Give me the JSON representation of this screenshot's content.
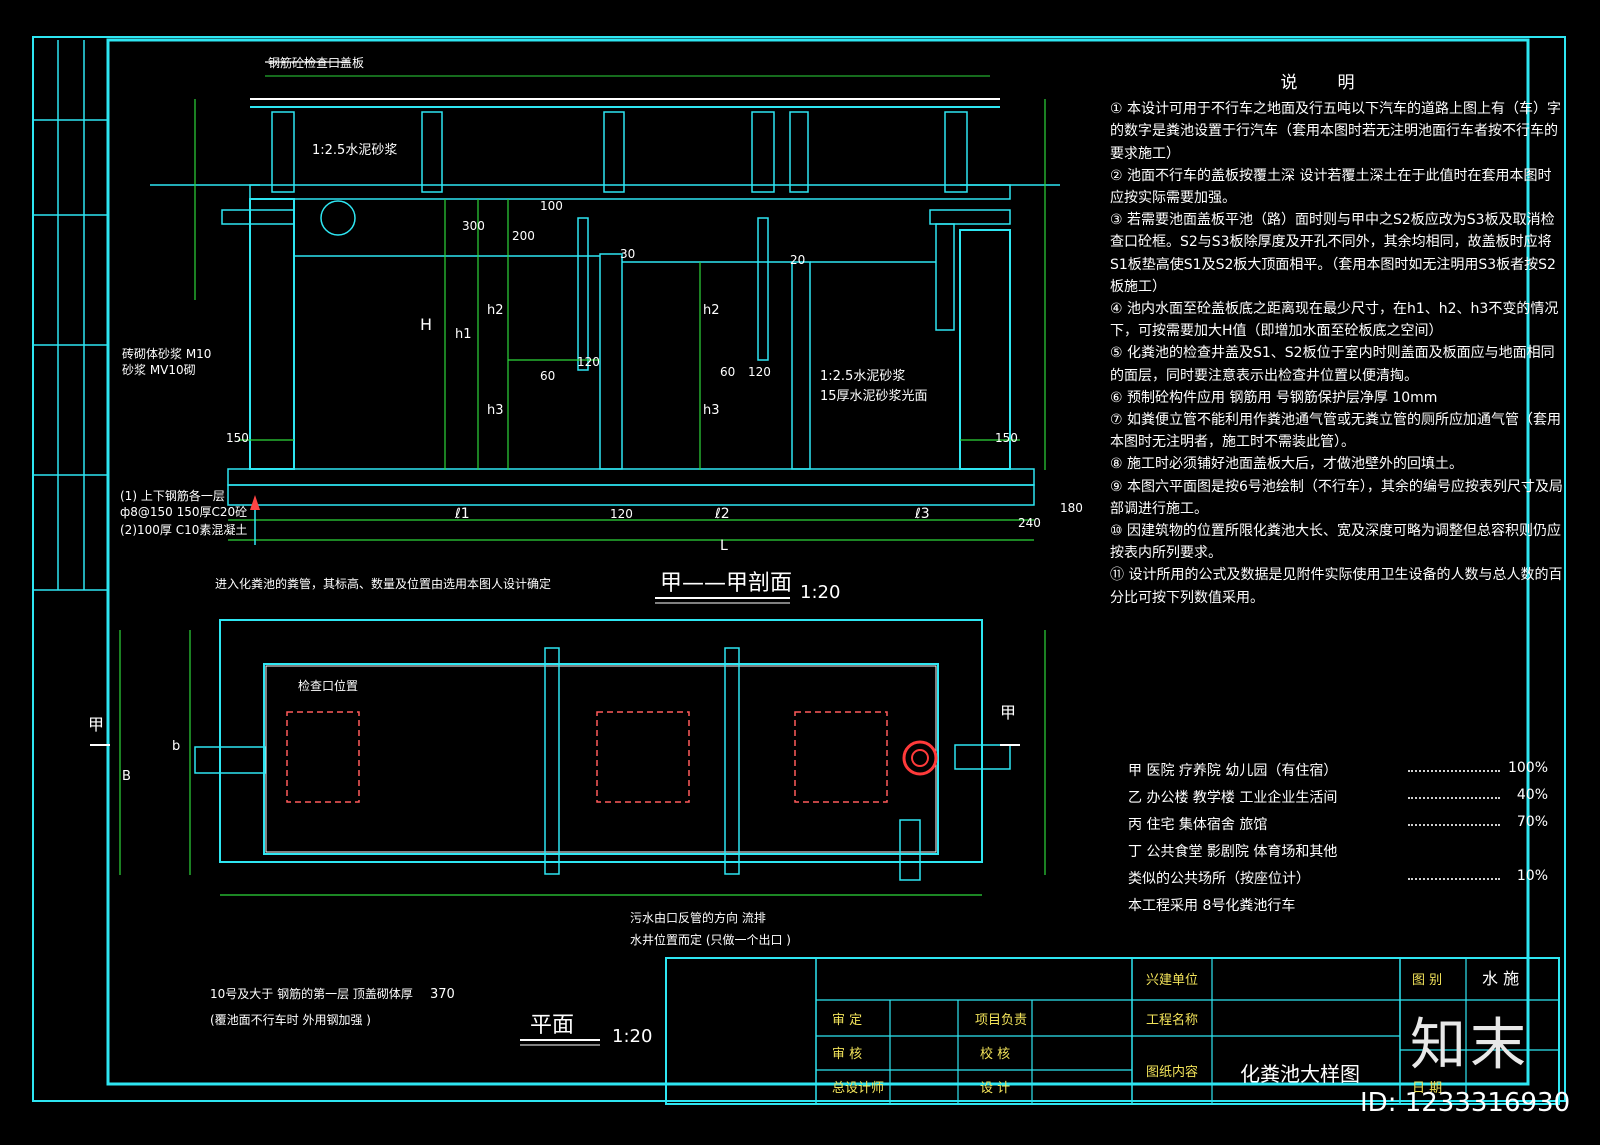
{
  "drawing": {
    "section_title": "甲——甲剖面",
    "section_scale": "1:20",
    "plan_title": "平面",
    "plan_scale": "1:20",
    "section_marker": "甲",
    "top_label": "钢筋砼检查口盖板",
    "wall_label": "砖砌体砂浆 M10",
    "wall_label2": "砂浆 MV10砌",
    "bottom_note_1": "(1) 上下钢筋各一层",
    "bottom_note_2": "ф8@150 150厚C20砼",
    "bottom_note_3": "(2)100厚 C10素混凝土",
    "plaster_note": "1:2.5水泥砂浆",
    "plaster_note2": "15厚水泥砂浆光面",
    "plan_note_top": "进入化粪池的粪管，其标高、数量及位置由选用本图人设计确定",
    "plan_note_bottom": "10号及大于  钢筋的第一层     顶盖砌体厚",
    "plan_note_bottom2": "(覆池面不行车时    外用钢加强 )",
    "outlet_note": "污水由口反管的方向    流排",
    "outlet_note2": "水井位置而定  (只做一个出口 )",
    "inspect_label": "检查口位置",
    "dims": {
      "d150a": "150",
      "d150b": "150",
      "d120a": "120",
      "d120b": "120",
      "d120c": "120",
      "d300": "300",
      "d200": "200",
      "d100": "100",
      "d60a": "60",
      "d60b": "60",
      "d30": "30",
      "d20": "20",
      "d240": "240",
      "d180": "180",
      "d370": "370",
      "l1": "ℓ1",
      "l2": "ℓ2",
      "l3": "ℓ3",
      "L": "L",
      "H": "H",
      "h1": "h1",
      "h2": "h2",
      "h3": "h3",
      "B": "B",
      "b": "b"
    }
  },
  "notes": {
    "title": "说明",
    "items": [
      "① 本设计可用于不行车之地面及行五吨以下汽车的道路上图上有（车）字的数字是粪池设置于行汽车（套用本图时若无注明池面行车者按不行车的要求施工）",
      "② 池面不行车的盖板按覆土深  设计若覆土深土在于此值时在套用本图时应按实际需要加强。",
      "③ 若需要池面盖板平池（路）面时则与甲中之S2板应改为S3板及取消检查口砼框。S2与S3板除厚度及开孔不同外，其余均相同，故盖板时应将S1板垫高使S1及S2板大顶面相平。（套用本图时如无注明用S3板者按S2板施工）",
      "④ 池内水面至砼盖板底之距离现在最少尺寸，在h1、h2、h3不变的情况下，可按需要加大H值（即增加水面至砼板底之空间）",
      "⑤ 化粪池的检查井盖及S1、S2板位于室内时则盖面及板面应与地面相同的面层，同时要注意表示出检查井位置以便清掏。",
      "⑥ 预制砼构件应用     钢筋用   号钢筋保护层净厚        10mm",
      "⑦ 如粪便立管不能利用作粪池通气管或无粪立管的厕所应加通气管（套用本图时无注明者，施工时不需装此管）。",
      "⑧ 施工时必须铺好池面盖板大后，才做池壁外的回填土。",
      "⑨ 本图六平面图是按6号池绘制（不行车），其余的编号应按表列尺寸及局部调进行施工。",
      "⑩ 因建筑物的位置所限化粪池大长、宽及深度可略为调整但总容积则仍应按表内所列要求。",
      "⑪ 设计所用的公式及数据是见附件实际使用卫生设备的人数与总人数的百分比可按下列数值采用。"
    ],
    "ratios": [
      {
        "label": "甲  医院    疗养院    幼儿园（有住宿）",
        "value": "100%"
      },
      {
        "label": "乙  办公楼    教学楼    工业企业生活间",
        "value": "40%"
      },
      {
        "label": "丙  住宅    集体宿舍    旅馆",
        "value": "70%"
      },
      {
        "label": "丁  公共食堂    影剧院    体育场和其他",
        "value": ""
      },
      {
        "label": "类似的公共场所（按座位计）",
        "value": "10%"
      }
    ],
    "final_line": "本工程采用    8号化粪池行车"
  },
  "title_block": {
    "build_unit": "兴建单位",
    "project_name": "工程名称",
    "drawing_content": "图纸内容",
    "drawing_name": "化粪池大样图",
    "approve": "审 定",
    "review": "审 核",
    "design_head": "总设计师",
    "project_lead": "项目负责",
    "check": "校 核",
    "design": "设 计",
    "drawing_no": "图 别",
    "discipline": "水 施",
    "date": "日 期"
  },
  "watermark": {
    "brand": "知末",
    "id": "ID: 1233316930"
  },
  "colors": {
    "frame": "#2ee6f2",
    "dimension": "#2dd63a",
    "text": "#ffffff",
    "highlight": "#f2e35a",
    "fitting": "#ff3a3a"
  }
}
